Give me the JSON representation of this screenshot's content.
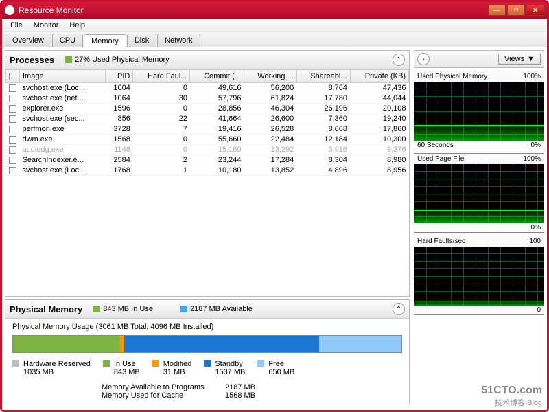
{
  "window": {
    "title": "Resource Monitor"
  },
  "menu": [
    "File",
    "Monitor",
    "Help"
  ],
  "tabs": [
    "Overview",
    "CPU",
    "Memory",
    "Disk",
    "Network"
  ],
  "active_tab": 2,
  "processes_panel": {
    "title": "Processes",
    "status": "27% Used Physical Memory",
    "columns": [
      "Image",
      "PID",
      "Hard Faul...",
      "Commit (...",
      "Working ...",
      "Shareabl...",
      "Private (KB)"
    ],
    "rows": [
      {
        "image": "svchost.exe (Loc...",
        "pid": 1004,
        "hard": 0,
        "commit": "49,616",
        "working": "56,200",
        "share": "8,764",
        "private": "47,436",
        "dim": false
      },
      {
        "image": "svchost.exe (net...",
        "pid": 1064,
        "hard": 30,
        "commit": "57,796",
        "working": "61,824",
        "share": "17,780",
        "private": "44,044",
        "dim": false
      },
      {
        "image": "explorer.exe",
        "pid": 1596,
        "hard": 0,
        "commit": "28,856",
        "working": "46,304",
        "share": "26,196",
        "private": "20,108",
        "dim": false
      },
      {
        "image": "svchost.exe (sec...",
        "pid": 856,
        "hard": 22,
        "commit": "41,664",
        "working": "26,600",
        "share": "7,360",
        "private": "19,240",
        "dim": false
      },
      {
        "image": "perfmon.exe",
        "pid": 3728,
        "hard": 7,
        "commit": "19,416",
        "working": "26,528",
        "share": "8,668",
        "private": "17,860",
        "dim": false
      },
      {
        "image": "dwm.exe",
        "pid": 1568,
        "hard": 0,
        "commit": "55,660",
        "working": "22,484",
        "share": "12,184",
        "private": "10,300",
        "dim": false
      },
      {
        "image": "audiodg.exe",
        "pid": 1148,
        "hard": 0,
        "commit": "15,180",
        "working": "13,292",
        "share": "3,916",
        "private": "9,376",
        "dim": true
      },
      {
        "image": "SearchIndexer.e...",
        "pid": 2584,
        "hard": 2,
        "commit": "23,244",
        "working": "17,284",
        "share": "8,304",
        "private": "8,980",
        "dim": false
      },
      {
        "image": "svchost.exe (Loc...",
        "pid": 1768,
        "hard": 1,
        "commit": "10,180",
        "working": "13,852",
        "share": "4,896",
        "private": "8,956",
        "dim": false
      }
    ]
  },
  "phys_panel": {
    "title": "Physical Memory",
    "inuse_text": "843 MB In Use",
    "avail_text": "2187 MB Available",
    "usage_line": "Physical Memory Usage (3061 MB Total, 4096 MB Installed)",
    "bar": {
      "hardware": 1035,
      "inuse": 843,
      "modified": 31,
      "standby": 1537,
      "free": 650,
      "installed": 4096
    },
    "legend": [
      {
        "color": "gray",
        "name": "Hardware Reserved",
        "val": "1035 MB"
      },
      {
        "color": "green",
        "name": "In Use",
        "val": "843 MB"
      },
      {
        "color": "orange",
        "name": "Modified",
        "val": "31 MB"
      },
      {
        "color": "darkblue",
        "name": "Standby",
        "val": "1537 MB"
      },
      {
        "color": "lightblue",
        "name": "Free",
        "val": "650 MB"
      }
    ],
    "avail_lines": [
      {
        "lbl": "Memory Available to Programs",
        "val": "2187 MB"
      },
      {
        "lbl": "Memory Used for Cache",
        "val": "1568 MB"
      }
    ]
  },
  "right": {
    "views_label": "Views",
    "charts": [
      {
        "title": "Used Physical Memory",
        "top_right": "100%",
        "bot_left": "60 Seconds",
        "bot_right": "0%",
        "fill": 27
      },
      {
        "title": "Used Page File",
        "top_right": "100%",
        "bot_left": "",
        "bot_right": "0%",
        "fill": 22
      },
      {
        "title": "Hard Faults/sec",
        "top_right": "100",
        "bot_left": "",
        "bot_right": "0",
        "fill": 8
      }
    ]
  },
  "chart_data": [
    {
      "type": "area",
      "title": "Used Physical Memory",
      "ylabel": "%",
      "ylim": [
        0,
        100
      ],
      "x_span_seconds": 60,
      "approx_value": 27
    },
    {
      "type": "area",
      "title": "Used Page File",
      "ylabel": "%",
      "ylim": [
        0,
        100
      ],
      "x_span_seconds": 60,
      "approx_value": 22
    },
    {
      "type": "area",
      "title": "Hard Faults/sec",
      "ylabel": "faults/sec",
      "ylim": [
        0,
        100
      ],
      "x_span_seconds": 60,
      "approx_value": 8
    }
  ],
  "watermark": {
    "line1": "51CTO.com",
    "line2": "技术博客    Blog"
  }
}
